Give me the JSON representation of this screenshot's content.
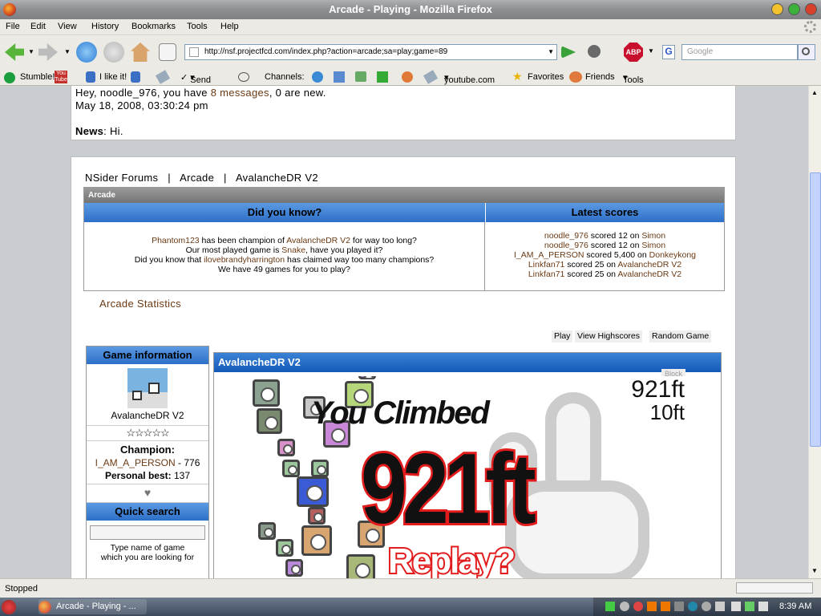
{
  "window": {
    "title": "Arcade - Playing - Mozilla Firefox"
  },
  "menu": [
    "File",
    "Edit",
    "View",
    "History",
    "Bookmarks",
    "Tools",
    "Help"
  ],
  "nav": {
    "url": "http://nsf.projectfcd.com/index.php?action=arcade;sa=play;game=89",
    "search_placeholder": "Google",
    "search_engine": "G"
  },
  "links": {
    "stumble": "Stumble!",
    "like": "I like it!",
    "send": "Send to",
    "channels": "Channels:",
    "youtube": "youtube.com",
    "favorites": "Favorites",
    "friends": "Friends",
    "tools": "Tools"
  },
  "user": {
    "greeting_pre": "Hey, noodle_976, you have ",
    "messages": "8 messages",
    "greeting_post": ", 0 are new.",
    "date": "May 18, 2008, 03:30:24 pm",
    "news_label": "News",
    "news_text": ": Hi."
  },
  "breadcrumb": [
    "NSider Forums",
    "Arcade",
    "AvalancheDR V2"
  ],
  "arcade": {
    "header": "Arcade",
    "did_you_know": {
      "title": "Did you know?",
      "line1_user": "Phantom123",
      "line1_mid": " has been champion of ",
      "line1_game": "AvalancheDR V2",
      "line1_end": " for way too long?",
      "line2_pre": "Our most played game is ",
      "line2_game": "Snake",
      "line2_end": ", have you played it?",
      "line3_pre": "Did you know that ",
      "line3_user": "ilovebrandyharrington",
      "line3_end": " has claimed way too many champions?",
      "line4": "We have 49 games for you to play?"
    },
    "latest": {
      "title": "Latest scores",
      "rows": [
        {
          "user": "noodle_976",
          "mid": " scored 12 on ",
          "game": "Simon"
        },
        {
          "user": "noodle_976",
          "mid": " scored 12 on ",
          "game": "Simon"
        },
        {
          "user": "I_AM_A_PERSON",
          "mid": " scored 5,400 on ",
          "game": "Donkeykong"
        },
        {
          "user": "Linkfan71",
          "mid": " scored 25 on ",
          "game": "AvalancheDR V2"
        },
        {
          "user": "Linkfan71",
          "mid": " scored 25 on ",
          "game": "AvalancheDR V2"
        }
      ]
    },
    "stats_link": "Arcade Statistics"
  },
  "buttons": {
    "play": "Play",
    "highscores": "View Highscores",
    "random": "Random Game"
  },
  "game_info": {
    "title": "Game information",
    "name": "AvalancheDR V2",
    "rating": "☆☆☆☆☆",
    "champion_label": "Champion:",
    "champion": "I_AM_A_PERSON",
    "champion_score": "- 776",
    "personal_label": "Personal best:",
    "personal_value": "137",
    "quick_search": "Quick search",
    "search_hint_1": "Type name of game",
    "search_hint_2": "which you are looking for"
  },
  "game": {
    "title": "AvalancheDR V2",
    "block_btn": "Block",
    "height_top": "921ft",
    "height_sub": "10ft",
    "climbed": "You Climbed",
    "big_score": "921ft",
    "replay": "Replay?"
  },
  "status": {
    "text": "Stopped"
  },
  "taskbar": {
    "task": "Arcade - Playing - ...",
    "clock": "8:39 AM"
  }
}
